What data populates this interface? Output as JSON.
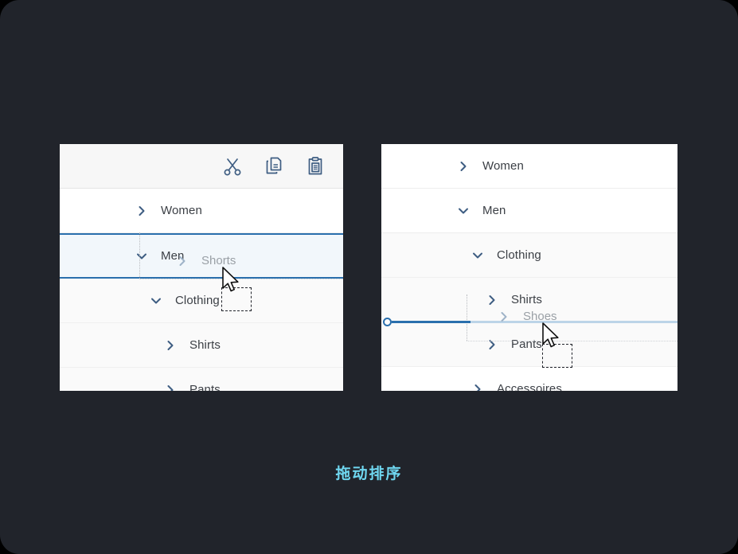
{
  "caption": "拖动排序",
  "watermark": "",
  "colors": {
    "background": "#21242b",
    "panel": "#ffffff",
    "toolbar": "#f7f7f7",
    "accent": "#2a6fad",
    "accent_faint": "#bcd4e8",
    "selected_row": "#f2f7fb",
    "caption": "#6fd7f0",
    "text": "#3b3f45",
    "ghost_text": "#9aa0a6",
    "arrow": "#3e5d82"
  },
  "left_panel": {
    "toolbar": {
      "buttons": [
        {
          "name": "cut-icon",
          "label": "Cut"
        },
        {
          "name": "copy-icon",
          "label": "Copy"
        },
        {
          "name": "paste-icon",
          "label": "Paste"
        }
      ]
    },
    "rows": [
      {
        "label": "Women",
        "arrow": "chevron-right",
        "level": 0,
        "state": "collapsed",
        "selected": false
      },
      {
        "label": "Men",
        "arrow": "chevron-down",
        "level": 0,
        "state": "expanded",
        "selected": true
      },
      {
        "label": "Clothing",
        "arrow": "chevron-down",
        "level": 1,
        "state": "expanded",
        "selected": false
      },
      {
        "label": "Shirts",
        "arrow": "chevron-right",
        "level": 2,
        "state": "collapsed",
        "selected": false
      },
      {
        "label": "Pants",
        "arrow": "chevron-right",
        "level": 2,
        "state": "collapsed",
        "selected": false
      }
    ],
    "ghost_row": {
      "label": "Shorts",
      "arrow": "chevron-right"
    }
  },
  "right_panel": {
    "rows": [
      {
        "label": "Women",
        "arrow": "chevron-right",
        "level": 0,
        "state": "collapsed"
      },
      {
        "label": "Men",
        "arrow": "chevron-down",
        "level": 0,
        "state": "expanded"
      },
      {
        "label": "Clothing",
        "arrow": "chevron-down",
        "level": 1,
        "state": "expanded"
      },
      {
        "label": "Shirts",
        "arrow": "chevron-right",
        "level": 2,
        "state": "collapsed"
      },
      {
        "label": "Pants",
        "arrow": "chevron-right",
        "level": 2,
        "state": "collapsed"
      },
      {
        "label": "Accessoires",
        "arrow": "chevron-right",
        "level": 1,
        "state": "collapsed"
      }
    ],
    "ghost_row": {
      "label": "Shoes",
      "arrow": "chevron-right"
    },
    "drop_indicator": {
      "name": "drop-position-line",
      "visible": true
    }
  }
}
